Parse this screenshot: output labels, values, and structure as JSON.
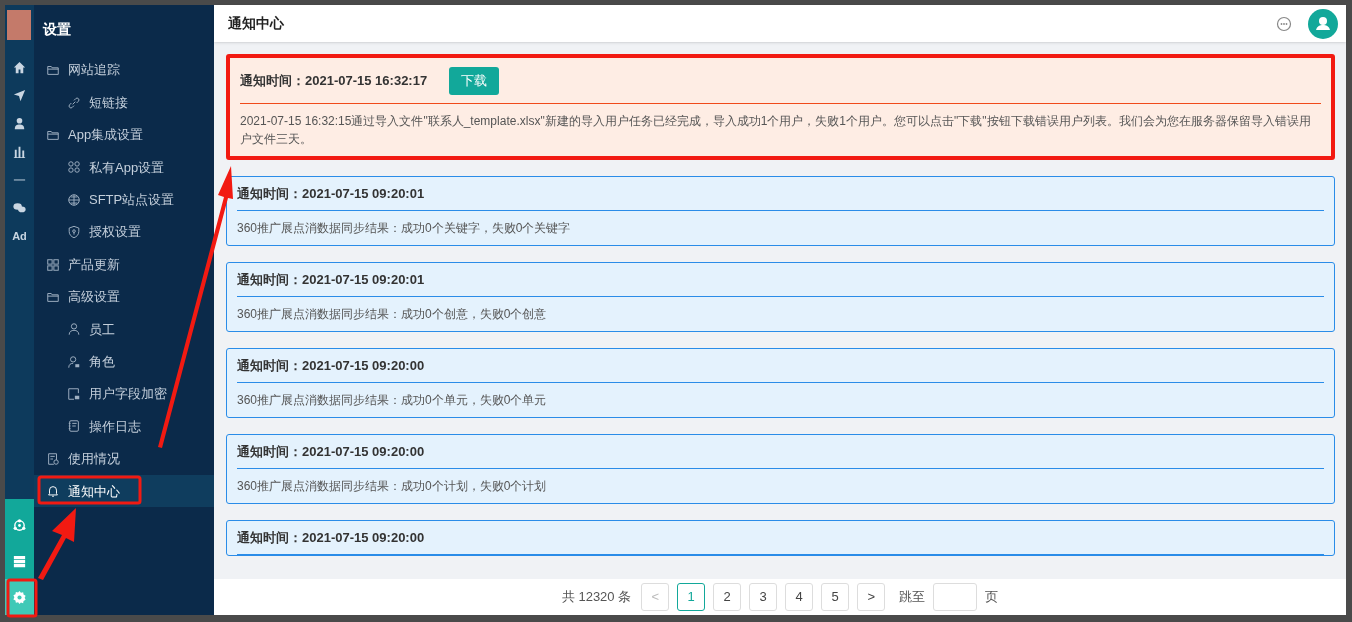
{
  "rail": {
    "items": [
      {
        "kind": "icon",
        "selected": false
      },
      {
        "kind": "icon",
        "selected": false
      },
      {
        "kind": "icon",
        "selected": false
      },
      {
        "kind": "icon",
        "selected": false
      },
      {
        "kind": "icon",
        "selected": false
      },
      {
        "kind": "icon",
        "selected": false
      },
      {
        "kind": "text",
        "label": "Ad",
        "selected": false
      }
    ],
    "bottom": [
      {
        "selected": false
      },
      {
        "selected": false
      },
      {
        "selected": true
      }
    ]
  },
  "sidebar": {
    "title": "设置",
    "items": [
      {
        "label": "网站追踪",
        "selected": false,
        "children": [
          {
            "label": "短链接",
            "selected": false
          }
        ]
      },
      {
        "label": "App集成设置",
        "selected": false,
        "children": [
          {
            "label": "私有App设置",
            "selected": false
          },
          {
            "label": "SFTP站点设置",
            "selected": false
          },
          {
            "label": "授权设置",
            "selected": false
          }
        ]
      },
      {
        "label": "产品更新",
        "selected": false
      },
      {
        "label": "高级设置",
        "selected": false,
        "children": [
          {
            "label": "员工",
            "selected": false
          },
          {
            "label": "角色",
            "selected": false
          },
          {
            "label": "用户字段加密",
            "selected": false
          },
          {
            "label": "操作日志",
            "selected": false
          }
        ]
      },
      {
        "label": "使用情况",
        "selected": false
      },
      {
        "label": "通知中心",
        "selected": true
      }
    ]
  },
  "header": {
    "title": "通知中心"
  },
  "notifications": [
    {
      "kind": "alert",
      "time": "通知时间：2021-07-15 16:32:17",
      "action": "下载",
      "body": "2021-07-15 16:32:15通过导入文件\"联系人_template.xlsx\"新建的导入用户任务已经完成，导入成功1个用户，失败1个用户。您可以点击\"下载\"按钮下载错误用户列表。我们会为您在服务器保留导入错误用户文件三天。"
    },
    {
      "kind": "info",
      "time": "通知时间：2021-07-15 09:20:01",
      "body": "360推广展点消数据同步结果：成功0个关键字，失败0个关键字"
    },
    {
      "kind": "info",
      "time": "通知时间：2021-07-15 09:20:01",
      "body": "360推广展点消数据同步结果：成功0个创意，失败0个创意"
    },
    {
      "kind": "info",
      "time": "通知时间：2021-07-15 09:20:00",
      "body": "360推广展点消数据同步结果：成功0个单元，失败0个单元"
    },
    {
      "kind": "info",
      "time": "通知时间：2021-07-15 09:20:00",
      "body": "360推广展点消数据同步结果：成功0个计划，失败0个计划"
    },
    {
      "kind": "info",
      "time": "通知时间：2021-07-15 09:20:00"
    }
  ],
  "pagination": {
    "total": "共 12320 条",
    "prev": "<",
    "next": ">",
    "pages": [
      {
        "label": "1",
        "selected": true
      },
      {
        "label": "2",
        "selected": false
      },
      {
        "label": "3",
        "selected": false
      },
      {
        "label": "4",
        "selected": false
      },
      {
        "label": "5",
        "selected": false
      }
    ],
    "jump_label": "跳至",
    "page_unit": "页"
  }
}
